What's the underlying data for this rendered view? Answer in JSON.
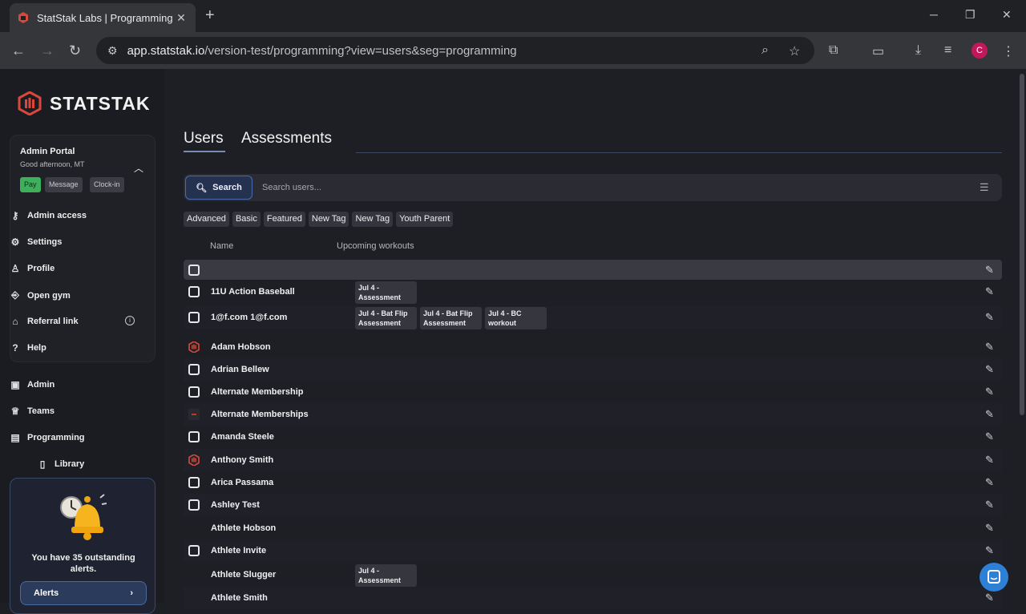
{
  "browser": {
    "tab_title": "StatStak Labs | Programming",
    "url_host": "app.statstak.io",
    "url_path": "/version-test/programming?view=users&seg=programming",
    "avatar_letter": "C"
  },
  "sidebar": {
    "brand": "STATSTAK",
    "portal_title": "Admin Portal",
    "greeting": "Good afternoon, MT",
    "chips": {
      "pay": "Pay",
      "message": "Message",
      "clock_in": "Clock-in"
    },
    "portal_items": [
      {
        "label": "Admin access",
        "icon": "key-icon"
      },
      {
        "label": "Settings",
        "icon": "gear-icon"
      },
      {
        "label": "Profile",
        "icon": "user-icon"
      },
      {
        "label": "Open gym",
        "icon": "door-icon"
      },
      {
        "label": "Referral link",
        "icon": "gift-icon"
      },
      {
        "label": "Help",
        "icon": "help-icon"
      }
    ],
    "nav_items": [
      {
        "label": "Admin",
        "icon": "briefcase-icon"
      },
      {
        "label": "Teams",
        "icon": "trophy-icon"
      },
      {
        "label": "Programming",
        "icon": "clipboard-icon"
      },
      {
        "label": "Library",
        "icon": "book-icon"
      }
    ],
    "alerts_text": "You have 35 outstanding alerts.",
    "alerts_button": "Alerts"
  },
  "main": {
    "tabs": [
      "Users",
      "Assessments"
    ],
    "search_button": "Search",
    "search_placeholder": "Search users...",
    "tags": [
      "Advanced",
      "Basic",
      "Featured",
      "New Tag",
      "New Tag",
      "Youth Parent"
    ],
    "columns": {
      "name": "Name",
      "workouts": "Upcoming workouts"
    },
    "rows": [
      {
        "name": "",
        "marker": "checkbox",
        "workouts": []
      },
      {
        "name": "11U Action Baseball",
        "marker": "checkbox",
        "workouts": [
          "Jul 4 - Assessment"
        ]
      },
      {
        "name": "1@f.com 1@f.com",
        "marker": "checkbox",
        "workouts": [
          "Jul 4 - Bat Flip Assessment",
          "Jul 4 - Bat Flip Assessment",
          "Jul 4 - BC workout"
        ]
      },
      {
        "name": "Adam Hobson",
        "marker": "logo",
        "workouts": []
      },
      {
        "name": "Adrian Bellew",
        "marker": "checkbox",
        "workouts": []
      },
      {
        "name": "Alternate Membership",
        "marker": "checkbox",
        "workouts": []
      },
      {
        "name": "Alternate Memberships",
        "marker": "photo",
        "workouts": []
      },
      {
        "name": "Amanda Steele",
        "marker": "checkbox",
        "workouts": []
      },
      {
        "name": "Anthony Smith",
        "marker": "logo",
        "workouts": []
      },
      {
        "name": "Arica Passama",
        "marker": "checkbox",
        "workouts": []
      },
      {
        "name": "Ashley Test",
        "marker": "checkbox",
        "workouts": []
      },
      {
        "name": "Athlete Hobson",
        "marker": "none",
        "workouts": []
      },
      {
        "name": "Athlete Invite",
        "marker": "checkbox",
        "workouts": []
      },
      {
        "name": "Athlete Slugger",
        "marker": "none",
        "workouts": [
          "Jul 4 - Assessment"
        ]
      },
      {
        "name": "Athlete Smith",
        "marker": "none",
        "workouts": []
      }
    ]
  },
  "colors": {
    "accent": "#4b6bb0",
    "brand": "#d9483b",
    "pay": "#3cb05a"
  }
}
